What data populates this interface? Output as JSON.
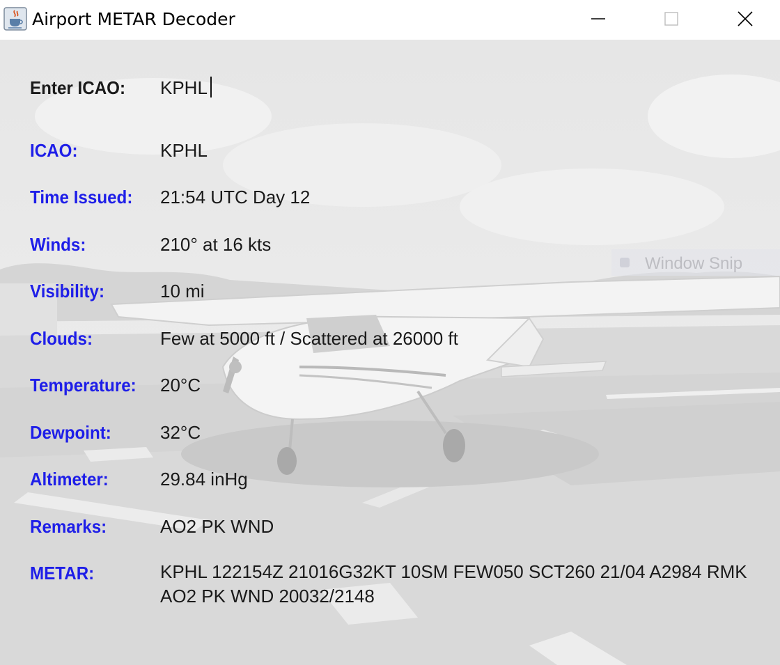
{
  "window": {
    "title": "Airport METAR Decoder",
    "icon": "java-cup-icon",
    "controls": [
      "minimize-icon",
      "maximize-icon",
      "close-icon"
    ]
  },
  "form": {
    "input_label": "Enter ICAO:",
    "input_value": "KPHL"
  },
  "fields": {
    "icao": {
      "label": "ICAO:",
      "value": "KPHL"
    },
    "time_issued": {
      "label": "Time Issued:",
      "value": "21:54 UTC Day 12"
    },
    "winds": {
      "label": "Winds:",
      "value": "210° at 16 kts"
    },
    "visibility": {
      "label": "Visibility:",
      "value": "10 mi"
    },
    "clouds": {
      "label": "Clouds:",
      "value": "Few at 5000 ft / Scattered at 26000 ft"
    },
    "temperature": {
      "label": "Temperature:",
      "value": "20°C"
    },
    "dewpoint": {
      "label": "Dewpoint:",
      "value": "32°C"
    },
    "altimeter": {
      "label": "Altimeter:",
      "value": "29.84 inHg"
    },
    "remarks": {
      "label": "Remarks:",
      "value": "AO2 PK WND"
    },
    "metar": {
      "label": "METAR:",
      "value": "KPHL 122154Z 21016G32KT 10SM FEW050 SCT260 21/04 A2984 RMK AO2 PK WND 20032/2148"
    }
  },
  "overlay": {
    "ghost_text": "Window Snip"
  },
  "colors": {
    "label_blue": "#1e1ee8",
    "text": "#1a1a1a",
    "background_wash": "#e9e9e9"
  }
}
